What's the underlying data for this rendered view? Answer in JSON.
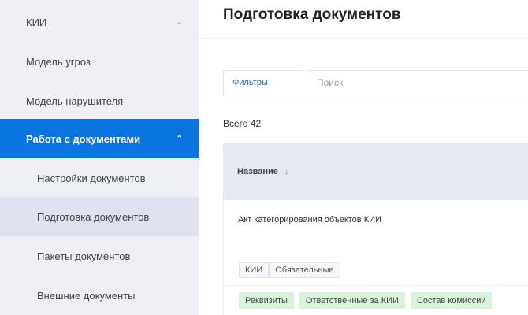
{
  "sidebar": {
    "items": [
      {
        "label": "КИИ",
        "chevron": "down"
      },
      {
        "label": "Модель угроз"
      },
      {
        "label": "Модель нарушителя"
      },
      {
        "label": "Работа с документами",
        "chevron": "up",
        "active": true
      },
      {
        "label": "Настройки документов"
      },
      {
        "label": "Подготовка документов",
        "selected": true
      },
      {
        "label": "Пакеты документов"
      },
      {
        "label": "Внешние документы"
      }
    ],
    "chev_down": "⌄",
    "chev_up": "⌃"
  },
  "header": {
    "title": "Подготовка документов"
  },
  "toolbar": {
    "filters_label": "Фильтры",
    "search_placeholder": "Поиск"
  },
  "total": "Всего 42",
  "table": {
    "column": "Название",
    "sort_icon": "↓",
    "rows": [
      {
        "name": "Акт категорирования объектов КИИ",
        "tags": [
          "КИИ",
          "Обязательные"
        ],
        "sections": [
          "Реквизиты",
          "Ответственные за КИИ",
          "Состав комиссии"
        ]
      }
    ]
  },
  "colors": {
    "accent": "#0a74e0",
    "section_tag": "#d8f5dc"
  }
}
